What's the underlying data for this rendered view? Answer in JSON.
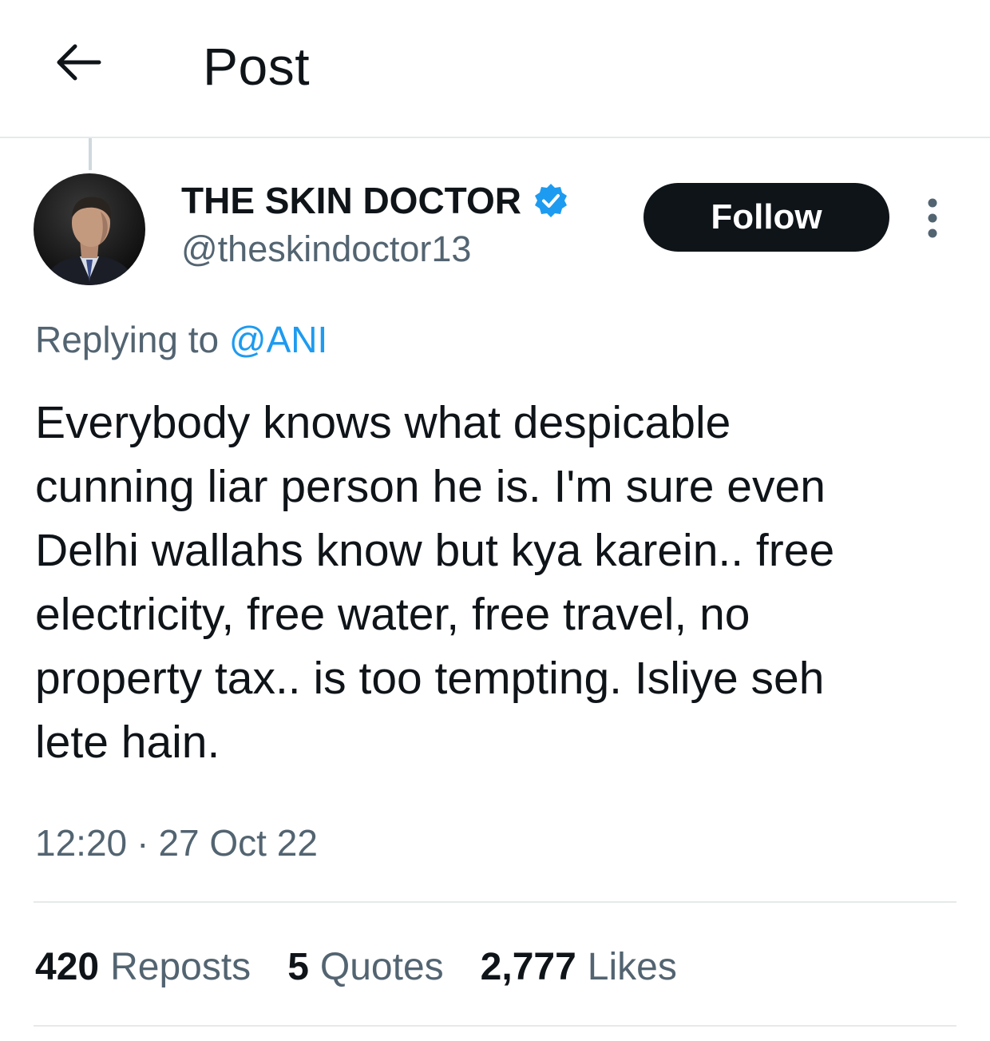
{
  "header": {
    "title": "Post",
    "back_icon": "arrow-left-icon"
  },
  "author": {
    "display_name": "THE SKIN DOCTOR",
    "handle": "@theskindoctor13",
    "verified": true,
    "verified_color": "#1d9bf0"
  },
  "follow_button": {
    "label": "Follow"
  },
  "reply": {
    "prefix": "Replying to",
    "mention": "@ANI"
  },
  "post": {
    "text": "Everybody knows what despicable\ncunning liar person he is. I'm sure even\nDelhi wallahs know but kya karein.. free\nelectricity, free water, free travel, no\nproperty tax.. is too tempting. Isliye seh\nlete hain.",
    "time": "12:20",
    "separator": "·",
    "date": "27 Oct 22"
  },
  "stats": {
    "reposts_count": "420",
    "reposts_label": "Reposts",
    "quotes_count": "5",
    "quotes_label": "Quotes",
    "likes_count": "2,777",
    "likes_label": "Likes"
  },
  "colors": {
    "text": "#0f1419",
    "secondary": "#536471",
    "link": "#1d9bf0",
    "follow_bg": "#0f1419"
  }
}
